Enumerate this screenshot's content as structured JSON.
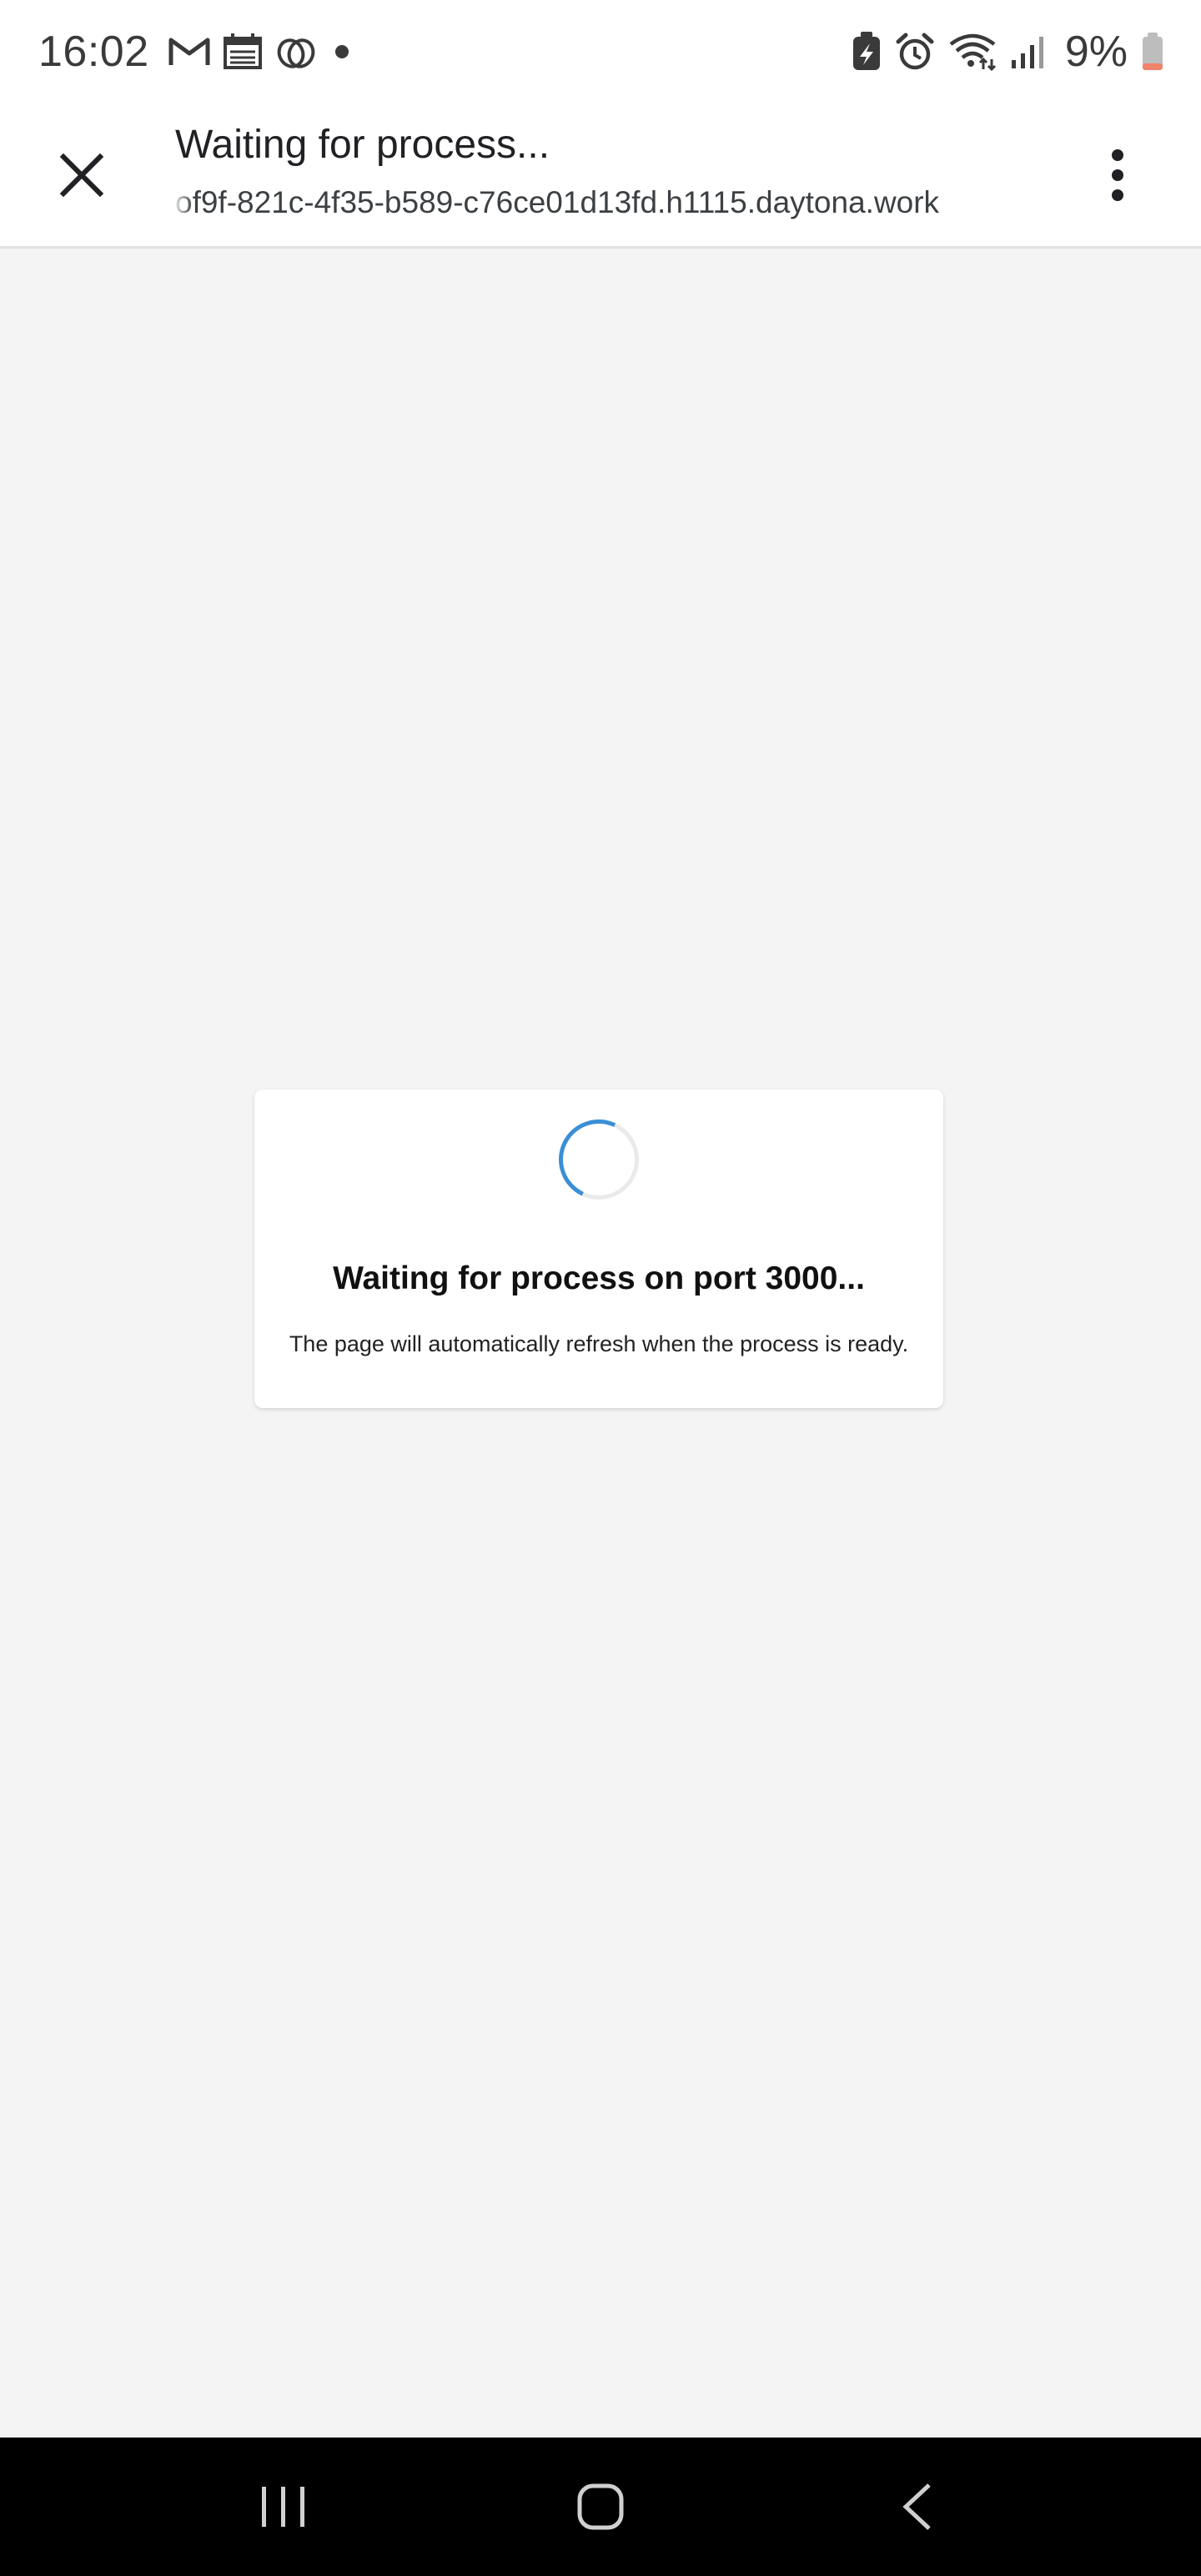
{
  "status_bar": {
    "time": "16:02",
    "battery_percent": "9%",
    "left_icons": [
      "gmail-icon",
      "calendar-icon",
      "app-icon",
      "dot-icon"
    ],
    "right_icons": [
      "battery-saver-icon",
      "alarm-icon",
      "wifi-icon",
      "signal-icon",
      "battery-icon"
    ]
  },
  "header": {
    "title": "Waiting for process...",
    "url": "of9f-821c-4f35-b589-c76ce01d13fd.h1115.daytona.work"
  },
  "card": {
    "title": "Waiting for process on port 3000...",
    "message": "The page will automatically refresh when the process is ready."
  },
  "colors": {
    "spinner_accent": "#3a8fd6",
    "page_background": "#f4f4f4",
    "nav_background": "#000000"
  }
}
